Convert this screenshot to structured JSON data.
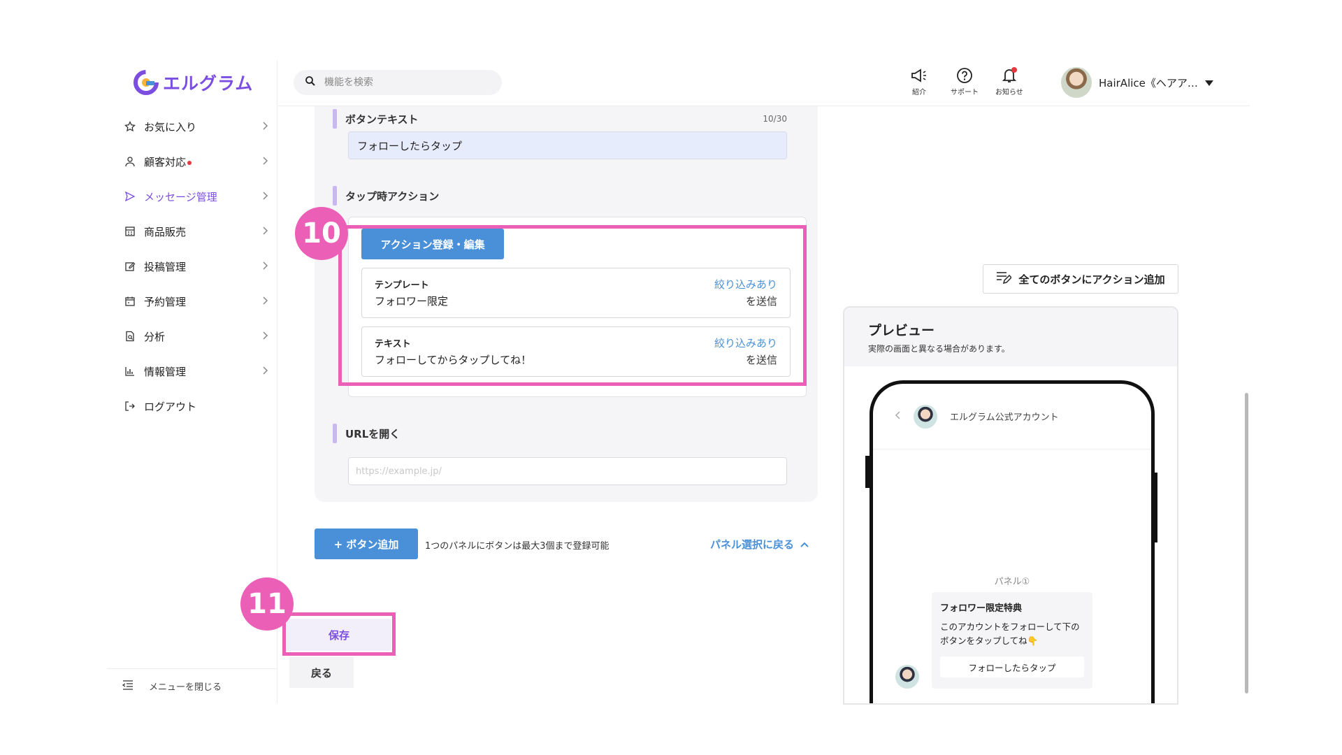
{
  "app": {
    "logo_text": "エルグラム",
    "brand_color": "#7b4ee0"
  },
  "sidebar": {
    "items": [
      {
        "label": "お気に入り",
        "icon": "star-icon"
      },
      {
        "label": "顧客対応",
        "icon": "user-icon",
        "notification_dot": true
      },
      {
        "label": "メッセージ管理",
        "icon": "send-icon",
        "active": true
      },
      {
        "label": "商品販売",
        "icon": "register-icon"
      },
      {
        "label": "投稿管理",
        "icon": "edit-icon"
      },
      {
        "label": "予約管理",
        "icon": "calendar-icon"
      },
      {
        "label": "分析",
        "icon": "report-icon"
      },
      {
        "label": "情報管理",
        "icon": "bar-chart-icon"
      },
      {
        "label": "ログアウト",
        "icon": "logout-icon"
      }
    ],
    "close_label": "メニューを閉じる"
  },
  "header": {
    "search_placeholder": "機能を検索",
    "intro_label": "紹介",
    "support_label": "サポート",
    "notice_label": "お知らせ",
    "user_name": "HairAlice《ヘアア…"
  },
  "form": {
    "button_text": {
      "heading": "ボタンテキスト",
      "counter": "10/30",
      "value": "フォローしたらタップ"
    },
    "tap_action": {
      "heading": "タップ時アクション",
      "edit_button": "アクション登録・編集",
      "actions": [
        {
          "type": "テンプレート",
          "content": "フォロワー限定",
          "filter": "絞り込みあり",
          "send": "を送信"
        },
        {
          "type": "テキスト",
          "content": "フォローしてからタップしてね！",
          "filter": "絞り込みあり",
          "send": "を送信"
        }
      ]
    },
    "url": {
      "heading": "URLを開く",
      "placeholder": "https://example.jp/"
    },
    "add_button": "+ ボタン追加",
    "add_note": "1つのパネルにボタンは最大3個まで登録可能",
    "back_to_panel": "パネル選択に戻る",
    "save": "保存",
    "back": "戻る"
  },
  "annotations": {
    "step_a": "10",
    "step_b": "11",
    "highlight_color": "#ec5fb7"
  },
  "preview": {
    "all_actions_button": "全てのボタンにアクション追加",
    "title": "プレビュー",
    "subtitle": "実際の画面と異なる場合があります。",
    "account_name": "エルグラム公式アカウント",
    "panel_label": "パネル①",
    "card_title": "フォロワー限定特典",
    "card_body": "このアカウントをフォローして下のボタンをタップしてね👇",
    "card_button": "フォローしたらタップ"
  }
}
